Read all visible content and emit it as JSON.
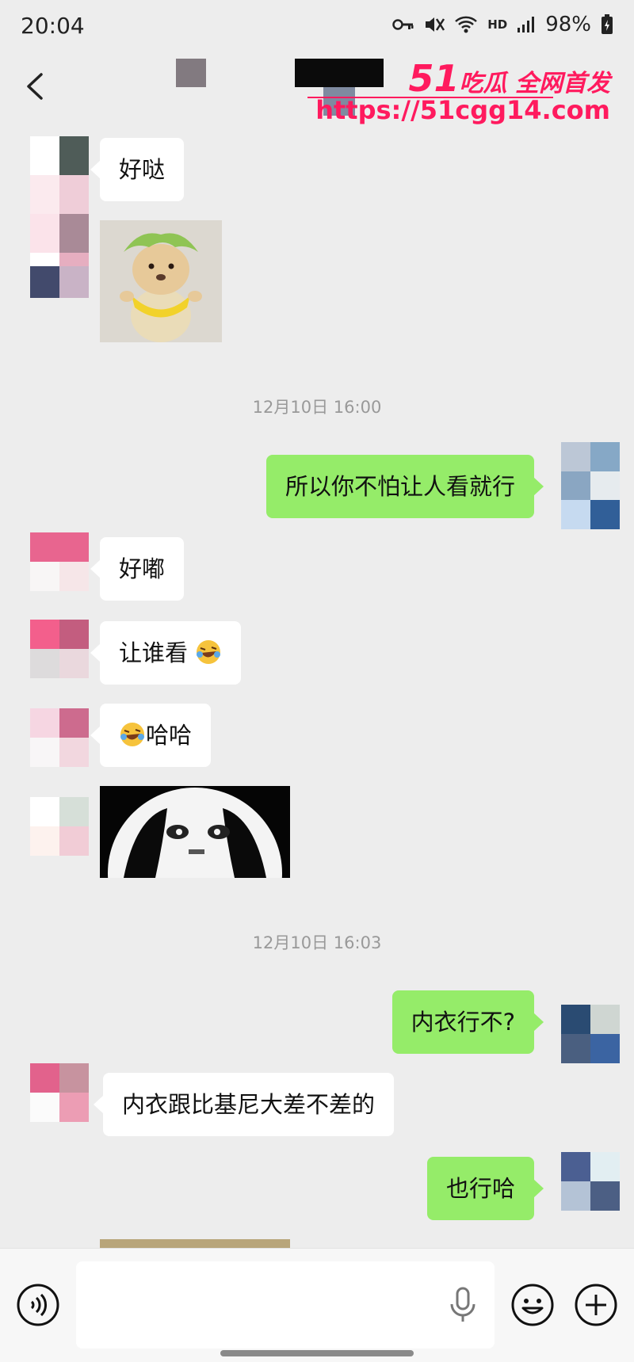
{
  "status_bar": {
    "time": "20:04",
    "hd": "HD",
    "battery": "98%"
  },
  "watermark": {
    "brand_num": "51",
    "brand_text": "吃瓜 全网首发",
    "url": "https://51cgg14.com"
  },
  "messages": [
    {
      "side": "left",
      "text": "好哒"
    },
    {
      "side": "left",
      "type": "sticker",
      "desc": "bear-with-leaf-hat"
    },
    {
      "type": "timestamp",
      "text": "12月10日 16:00"
    },
    {
      "side": "right",
      "text": "所以你不怕让人看就行"
    },
    {
      "side": "left",
      "text": "好嘟"
    },
    {
      "side": "left",
      "text": "让谁看",
      "emoji": "rolling-laugh"
    },
    {
      "side": "left",
      "text": "哈哈",
      "emoji": "rolling-laugh"
    },
    {
      "side": "left",
      "type": "sticker",
      "desc": "meme-face"
    },
    {
      "type": "timestamp",
      "text": "12月10日 16:03"
    },
    {
      "side": "right",
      "text": "内衣行不?"
    },
    {
      "side": "left",
      "text": "内衣跟比基尼大差不差的"
    },
    {
      "side": "right",
      "text": "也行哈"
    }
  ],
  "colors": {
    "self_bubble": "#95ec69",
    "other_bubble": "#ffffff",
    "background": "#ededed"
  },
  "input_bar": {
    "value": ""
  }
}
